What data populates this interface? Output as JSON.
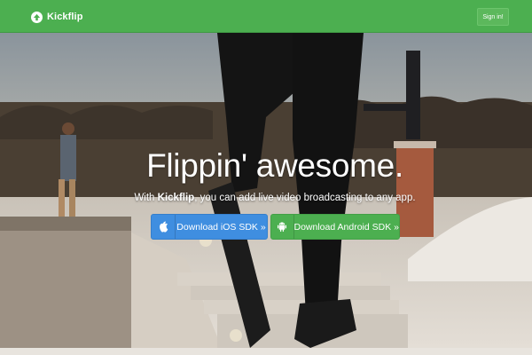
{
  "navbar": {
    "brand": "Kickflip",
    "brand_icon": "arrow-up-circle-icon",
    "signin_label": "Sign in!"
  },
  "hero": {
    "headline": "Flippin' awesome.",
    "tagline_prefix": "With ",
    "tagline_brand": "Kickflip",
    "tagline_suffix": ", you can add live video broadcasting to any app."
  },
  "buttons": {
    "ios": {
      "label": "Download iOS SDK »",
      "icon": "apple-icon"
    },
    "android": {
      "label": "Download Android SDK »",
      "icon": "android-icon"
    }
  },
  "colors": {
    "navbar": "#4caf50",
    "ios_button": "#3f8ee0",
    "android_button": "#4caf50",
    "text": "#ffffff"
  }
}
